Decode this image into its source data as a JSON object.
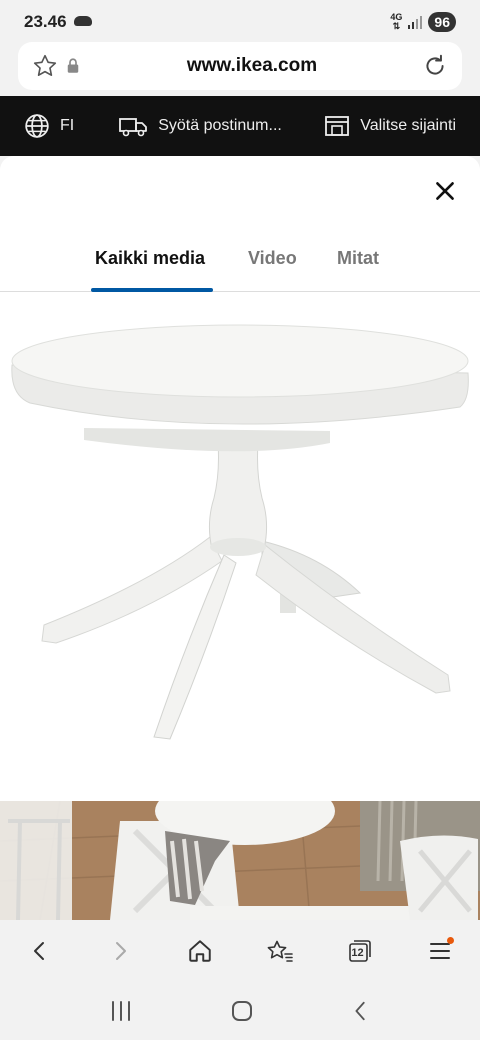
{
  "status": {
    "time": "23.46",
    "network": "4G",
    "battery": "96"
  },
  "browser": {
    "url": "www.ikea.com",
    "tab_count": "12"
  },
  "ikea_header": {
    "language": "FI",
    "postcode_label": "Syötä postinum...",
    "location_label": "Valitse sijainti"
  },
  "modal": {
    "tabs": [
      {
        "label": "Kaikki media",
        "active": true
      },
      {
        "label": "Video",
        "active": false
      },
      {
        "label": "Mitat",
        "active": false
      }
    ]
  },
  "colors": {
    "accent": "#0058a3",
    "header_bg": "#111111",
    "notification_dot": "#e8590c"
  }
}
